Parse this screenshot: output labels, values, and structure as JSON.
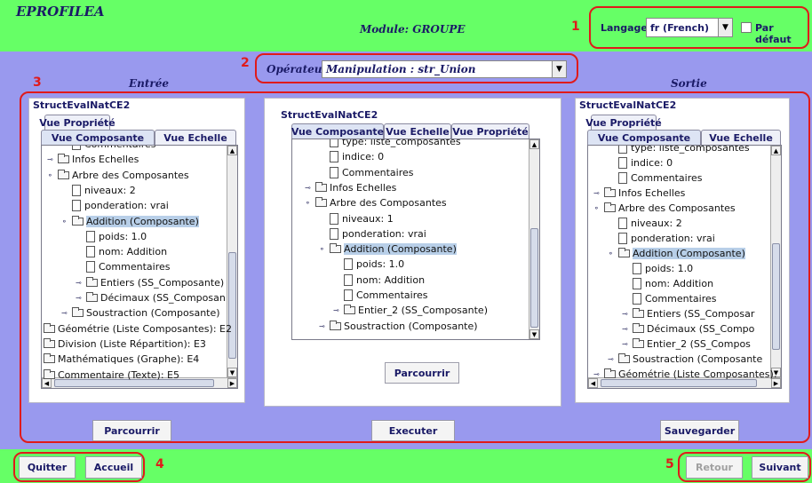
{
  "app": {
    "title": "EPROFILEA",
    "module": "Module: GROUPE"
  },
  "language": {
    "label": "Langage",
    "value": "fr (French)",
    "default_label": "Par défaut",
    "default_checked": false
  },
  "operator": {
    "label": "Opérateur:",
    "value": "Manipulation : str_Union"
  },
  "columns": {
    "input": "Entrée",
    "output": "Sortie"
  },
  "annotations": [
    "1",
    "2",
    "3",
    "4",
    "5"
  ],
  "left_panel": {
    "title": "StructEvalNatCE2",
    "tabs": [
      "Vue Propriété",
      "Vue Composante",
      "Vue Echelle"
    ],
    "tree": [
      {
        "label": "Commentaires",
        "icon": "file",
        "depth": 1
      },
      {
        "label": "Infos Echelles",
        "icon": "folder",
        "depth": 0,
        "toggle": "collapsed"
      },
      {
        "label": "Arbre des Composantes",
        "icon": "folder",
        "depth": 0,
        "toggle": "expanded"
      },
      {
        "label": "niveaux: 2",
        "icon": "file",
        "depth": 1
      },
      {
        "label": "ponderation: vrai",
        "icon": "file",
        "depth": 1
      },
      {
        "label": "Addition (Composante)",
        "icon": "folder",
        "depth": 1,
        "toggle": "expanded",
        "selected": true
      },
      {
        "label": "poids: 1.0",
        "icon": "file",
        "depth": 2
      },
      {
        "label": "nom: Addition",
        "icon": "file",
        "depth": 2
      },
      {
        "label": "Commentaires",
        "icon": "file",
        "depth": 2
      },
      {
        "label": "Entiers (SS_Composante)",
        "icon": "folder",
        "depth": 2,
        "toggle": "collapsed"
      },
      {
        "label": "Décimaux (SS_Composan",
        "icon": "folder",
        "depth": 2,
        "toggle": "collapsed"
      },
      {
        "label": "Soustraction (Composante)",
        "icon": "folder",
        "depth": 1,
        "toggle": "collapsed"
      },
      {
        "label": "Géométrie (Liste Composantes): E2",
        "icon": "folder",
        "depth": -1
      },
      {
        "label": "Division (Liste Répartition): E3",
        "icon": "folder",
        "depth": -1
      },
      {
        "label": "Mathématiques (Graphe): E4",
        "icon": "folder",
        "depth": -1
      },
      {
        "label": "Commentaire (Texte): E5",
        "icon": "folder",
        "depth": -1
      }
    ]
  },
  "center_panel": {
    "title": "StructEvalNatCE2",
    "tabs": [
      "Vue Composante",
      "Vue Echelle",
      "Vue Propriété"
    ],
    "tree": [
      {
        "label": "type: liste_composantes",
        "icon": "file",
        "depth": 1
      },
      {
        "label": "indice: 0",
        "icon": "file",
        "depth": 1
      },
      {
        "label": "Commentaires",
        "icon": "file",
        "depth": 1
      },
      {
        "label": "Infos Echelles",
        "icon": "folder",
        "depth": 0,
        "toggle": "collapsed"
      },
      {
        "label": "Arbre des Composantes",
        "icon": "folder",
        "depth": 0,
        "toggle": "expanded"
      },
      {
        "label": "niveaux: 1",
        "icon": "file",
        "depth": 1
      },
      {
        "label": "ponderation: vrai",
        "icon": "file",
        "depth": 1
      },
      {
        "label": "Addition (Composante)",
        "icon": "folder",
        "depth": 1,
        "toggle": "expanded",
        "selected": true
      },
      {
        "label": "poids: 1.0",
        "icon": "file",
        "depth": 2
      },
      {
        "label": "nom: Addition",
        "icon": "file",
        "depth": 2
      },
      {
        "label": "Commentaires",
        "icon": "file",
        "depth": 2
      },
      {
        "label": "Entier_2 (SS_Composante)",
        "icon": "folder",
        "depth": 2,
        "toggle": "collapsed"
      },
      {
        "label": "Soustraction (Composante)",
        "icon": "folder",
        "depth": 1,
        "toggle": "collapsed"
      }
    ]
  },
  "right_panel": {
    "title": "StructEvalNatCE2",
    "tabs": [
      "Vue Propriété",
      "Vue Composante",
      "Vue Echelle"
    ],
    "tree": [
      {
        "label": "type: liste_composantes",
        "icon": "file",
        "depth": 1
      },
      {
        "label": "indice: 0",
        "icon": "file",
        "depth": 1
      },
      {
        "label": "Commentaires",
        "icon": "file",
        "depth": 1
      },
      {
        "label": "Infos Echelles",
        "icon": "folder",
        "depth": 0,
        "toggle": "collapsed"
      },
      {
        "label": "Arbre des Composantes",
        "icon": "folder",
        "depth": 0,
        "toggle": "expanded"
      },
      {
        "label": "niveaux: 2",
        "icon": "file",
        "depth": 1
      },
      {
        "label": "ponderation: vrai",
        "icon": "file",
        "depth": 1
      },
      {
        "label": "Addition (Composante)",
        "icon": "folder",
        "depth": 1,
        "toggle": "expanded",
        "selected": true
      },
      {
        "label": "poids: 1.0",
        "icon": "file",
        "depth": 2
      },
      {
        "label": "nom: Addition",
        "icon": "file",
        "depth": 2
      },
      {
        "label": "Commentaires",
        "icon": "file",
        "depth": 2
      },
      {
        "label": "Entiers (SS_Composar",
        "icon": "folder",
        "depth": 2,
        "toggle": "collapsed"
      },
      {
        "label": "Décimaux (SS_Compo",
        "icon": "folder",
        "depth": 2,
        "toggle": "collapsed"
      },
      {
        "label": "Entier_2 (SS_Compos",
        "icon": "folder",
        "depth": 2,
        "toggle": "collapsed"
      },
      {
        "label": "Soustraction (Composante",
        "icon": "folder",
        "depth": 1,
        "toggle": "collapsed"
      },
      {
        "label": "Géométrie (Liste Composantes): E",
        "icon": "folder",
        "depth": 0,
        "toggle": "collapsed"
      }
    ]
  },
  "buttons": {
    "browse": "Parcourrir",
    "execute": "Executer",
    "save": "Sauvegarder",
    "quit": "Quitter",
    "home": "Accueil",
    "back": "Retour",
    "next": "Suivant"
  }
}
